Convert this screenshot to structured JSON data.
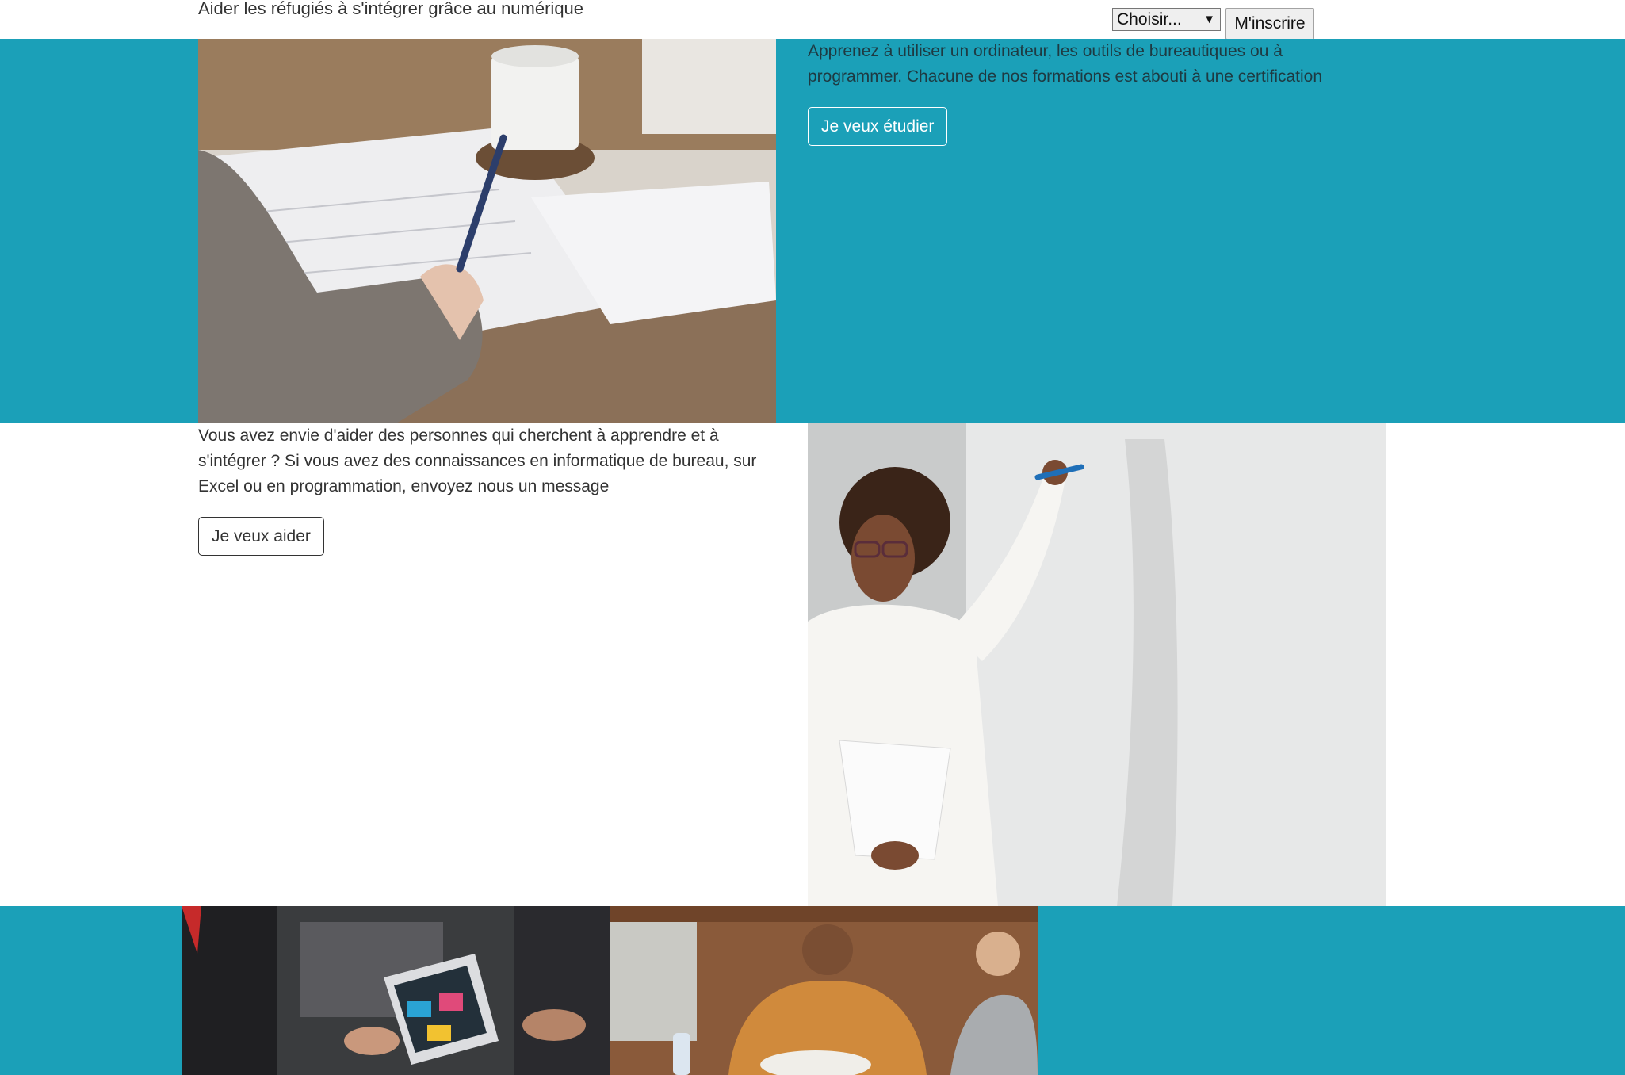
{
  "header": {
    "tagline": "Aider les réfugiés à s'intégrer grâce au numérique",
    "signup": {
      "select_value": "Choisir...",
      "submit_label": "M'inscrire"
    }
  },
  "study_section": {
    "text": "Apprenez à utiliser un ordinateur, les outils de bureautiques ou à programmer. Chacune de nos formations est abouti à une certification",
    "button_label": "Je veux étudier"
  },
  "help_section": {
    "text": "Vous avez envie d'aider des personnes qui cherchent à apprendre et à s'intégrer ? Si vous avez des connaissances en informatique de bureau, sur Excel ou en programmation, envoyez nous un message",
    "button_label": "Je veux aider"
  },
  "colors": {
    "teal": "#1ba0b8",
    "white": "#ffffff",
    "text": "#333333"
  }
}
